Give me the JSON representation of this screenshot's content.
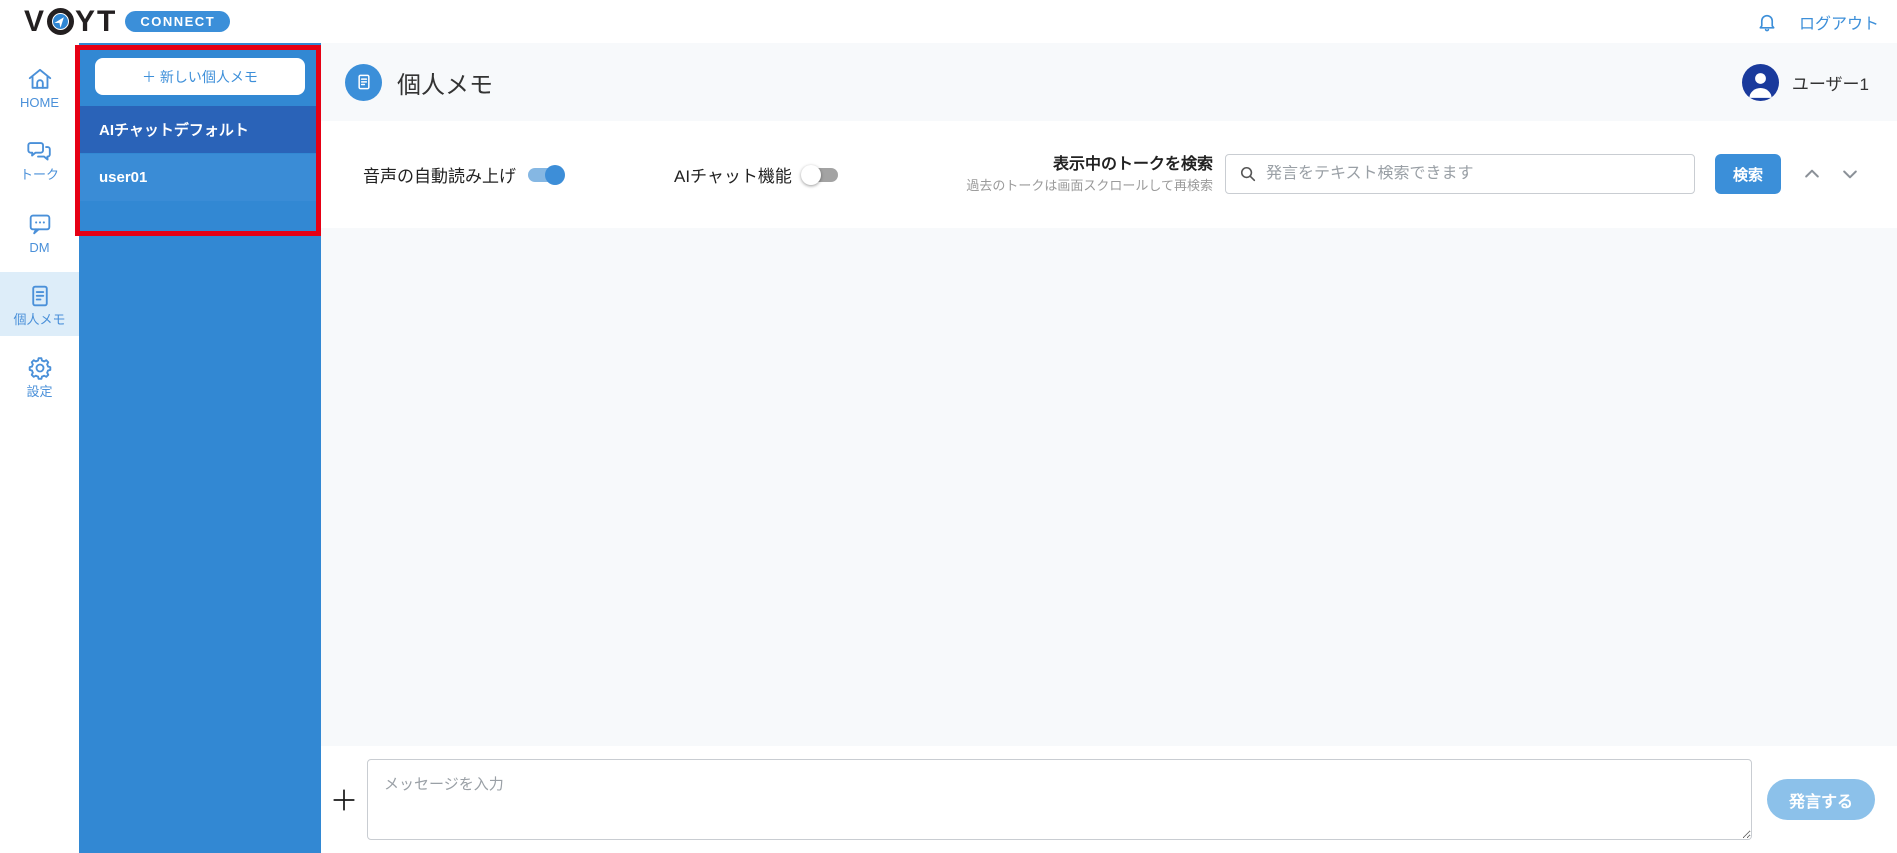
{
  "header": {
    "logo_text_v": "V",
    "logo_text_yt": "YT",
    "logo_badge": "CONNECT",
    "logout_label": "ログアウト"
  },
  "nav": {
    "items": [
      {
        "label": "HOME",
        "icon": "home-icon",
        "active": false
      },
      {
        "label": "トーク",
        "icon": "talk-icon",
        "active": false
      },
      {
        "label": "DM",
        "icon": "dm-icon",
        "active": false
      },
      {
        "label": "個人メモ",
        "icon": "memo-icon",
        "active": true
      },
      {
        "label": "設定",
        "icon": "gear-icon",
        "active": false
      }
    ]
  },
  "memo_panel": {
    "new_memo_button": "＋ 新しい個人メモ",
    "items": [
      {
        "label": "AIチャットデフォルト",
        "selected": true
      },
      {
        "label": "user01",
        "selected": false
      }
    ],
    "annotation_color": "#e60014"
  },
  "main": {
    "title": "個人メモ",
    "user_name": "ユーザー1",
    "toolbar": {
      "voice_toggle_label": "音声の自動読み上げ",
      "voice_toggle_on": true,
      "ai_toggle_label": "AIチャット機能",
      "ai_toggle_on": false,
      "search_title": "表示中のトークを検索",
      "search_subtitle": "過去のトークは画面スクロールして再検索",
      "search_placeholder": "発言をテキスト検索できます",
      "search_button_label": "検索"
    },
    "composer": {
      "message_placeholder": "メッセージを入力",
      "send_button_label": "発言する"
    }
  },
  "colors": {
    "brand_blue": "#3b8fd9",
    "panel_blue": "#3288d3",
    "selected_blue": "#2a63b8",
    "annotation_red": "#e60014",
    "avatar_blue": "#1a3a9c",
    "send_button_blue": "#8cc1ea"
  }
}
